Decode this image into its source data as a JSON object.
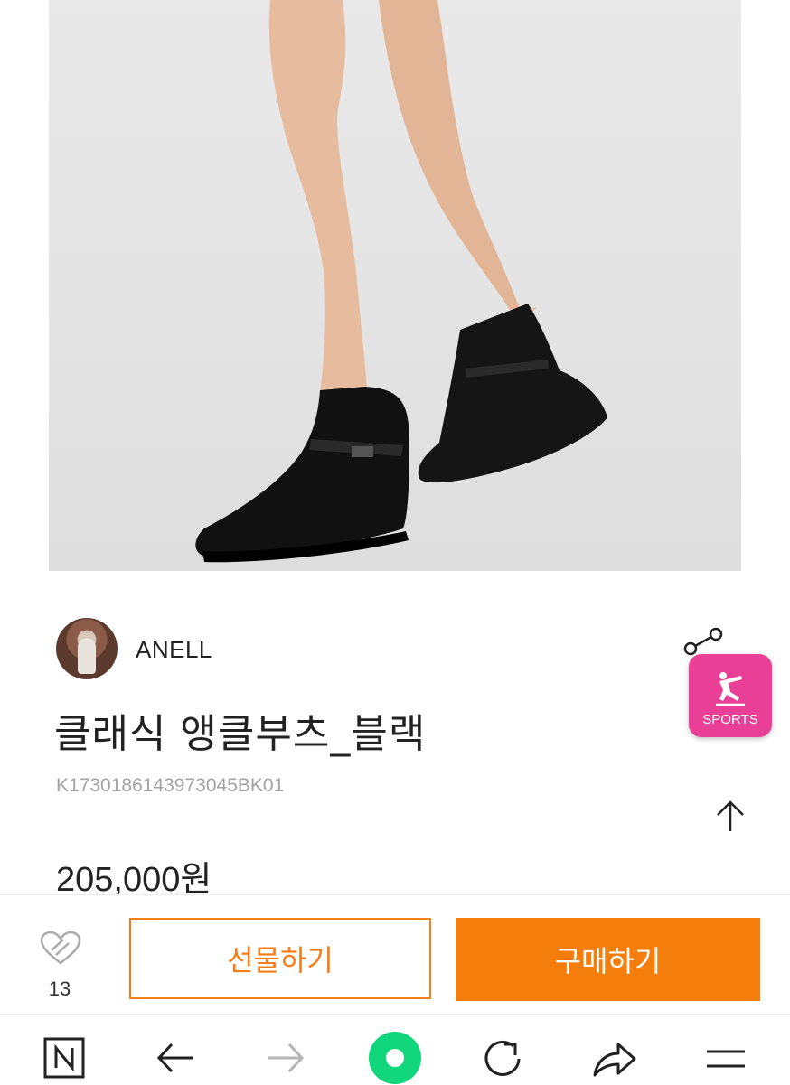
{
  "product": {
    "image_alt": "",
    "seller_name": "ANELL",
    "title": "클래식 앵클부츠_블랙",
    "code": "K1730186143973045BK01",
    "price": "205,000원"
  },
  "badge": {
    "label": "SPORTS",
    "color": "#e93f96"
  },
  "actions": {
    "like_count": "13",
    "gift_label": "선물하기",
    "buy_label": "구매하기",
    "accent": "#f57d0c"
  },
  "browser_nav": {
    "icons": [
      "naver-n-icon",
      "back-arrow-icon",
      "forward-arrow-icon",
      "home-dot-icon",
      "refresh-icon",
      "share-arrow-icon",
      "menu-icon"
    ],
    "home_color": "#11d67b"
  }
}
